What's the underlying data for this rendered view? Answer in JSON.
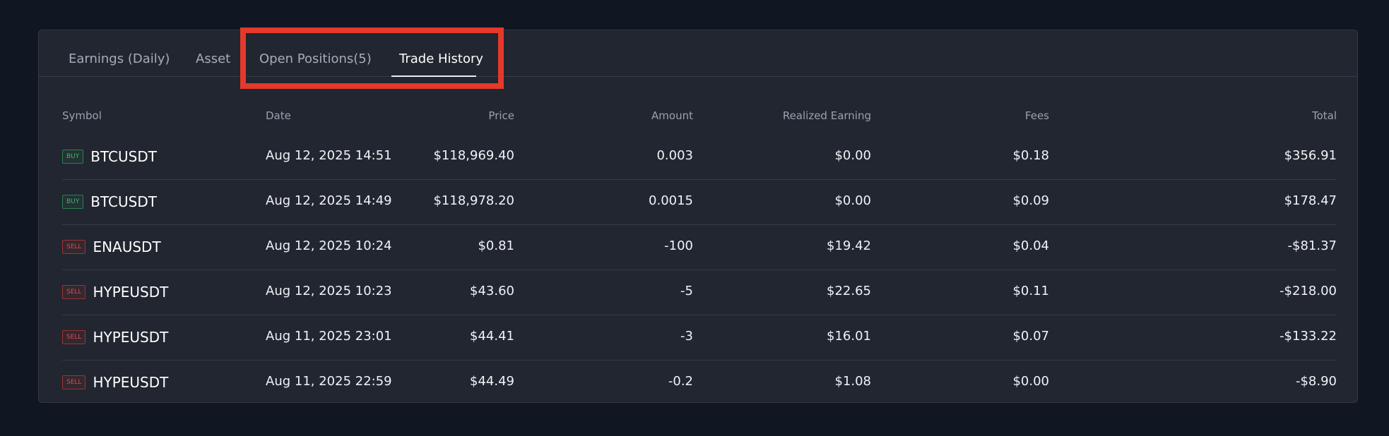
{
  "tabs": [
    {
      "label": "Earnings (Daily)"
    },
    {
      "label": "Asset"
    },
    {
      "label": "Open Positions(5)"
    },
    {
      "label": "Trade History",
      "active": true
    }
  ],
  "table": {
    "columns": [
      "Symbol",
      "Date",
      "Price",
      "Amount",
      "Realized Earning",
      "Fees",
      "Total"
    ],
    "rows": [
      {
        "side": "BUY",
        "symbol": "BTCUSDT",
        "date": "Aug 12, 2025 14:51",
        "price": "$118,969.40",
        "amount": "0.003",
        "realized": "$0.00",
        "fees": "$0.18",
        "total": "$356.91"
      },
      {
        "side": "BUY",
        "symbol": "BTCUSDT",
        "date": "Aug 12, 2025 14:49",
        "price": "$118,978.20",
        "amount": "0.0015",
        "realized": "$0.00",
        "fees": "$0.09",
        "total": "$178.47"
      },
      {
        "side": "SELL",
        "symbol": "ENAUSDT",
        "date": "Aug 12, 2025 10:24",
        "price": "$0.81",
        "amount": "-100",
        "realized": "$19.42",
        "fees": "$0.04",
        "total": "-$81.37"
      },
      {
        "side": "SELL",
        "symbol": "HYPEUSDT",
        "date": "Aug 12, 2025 10:23",
        "price": "$43.60",
        "amount": "-5",
        "realized": "$22.65",
        "fees": "$0.11",
        "total": "-$218.00"
      },
      {
        "side": "SELL",
        "symbol": "HYPEUSDT",
        "date": "Aug 11, 2025 23:01",
        "price": "$44.41",
        "amount": "-3",
        "realized": "$16.01",
        "fees": "$0.07",
        "total": "-$133.22"
      },
      {
        "side": "SELL",
        "symbol": "HYPEUSDT",
        "date": "Aug 11, 2025 22:59",
        "price": "$44.49",
        "amount": "-0.2",
        "realized": "$1.08",
        "fees": "$0.00",
        "total": "-$8.90"
      }
    ]
  },
  "colors": {
    "background": "#111722",
    "panel": "#212630",
    "buy": "#3fb56e",
    "sell": "#e04b4b",
    "highlight": "#e4392b"
  }
}
